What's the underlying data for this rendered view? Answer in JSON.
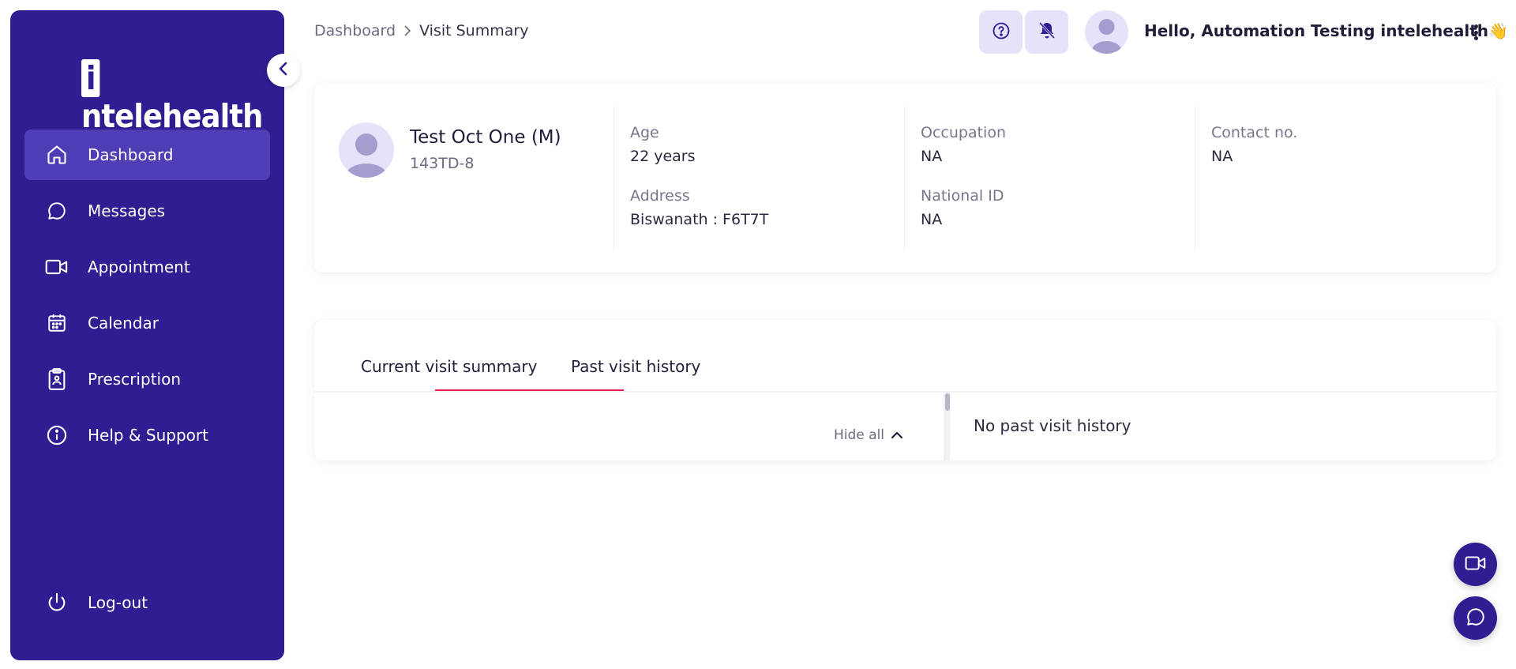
{
  "app": {
    "logo_text": "intelehealth"
  },
  "sidebar": {
    "items": [
      {
        "label": "Dashboard",
        "icon": "home-icon",
        "active": true
      },
      {
        "label": "Messages",
        "icon": "chat-bubble-icon",
        "active": false
      },
      {
        "label": "Appointment",
        "icon": "video-camera-icon",
        "active": false
      },
      {
        "label": "Calendar",
        "icon": "calendar-icon",
        "active": false
      },
      {
        "label": "Prescription",
        "icon": "clipboard-icon",
        "active": false
      },
      {
        "label": "Help & Support",
        "icon": "info-icon",
        "active": false
      }
    ],
    "logout_label": "Log-out"
  },
  "breadcrumb": {
    "root": "Dashboard",
    "current": "Visit Summary"
  },
  "header": {
    "greeting": "Hello, Automation Testing intelehealth",
    "greeting_emoji": "👋"
  },
  "patient": {
    "name": "Test Oct One (M)",
    "id": "143TD-8",
    "age_label": "Age",
    "age_value": "22 years",
    "address_label": "Address",
    "address_value": "Biswanath : F6T7T",
    "occupation_label": "Occupation",
    "occupation_value": "NA",
    "national_id_label": "National ID",
    "national_id_value": "NA",
    "contact_label": "Contact no.",
    "contact_value": "NA"
  },
  "visit": {
    "tabs": [
      {
        "label": "Current visit summary",
        "active": false
      },
      {
        "label": "Past visit history",
        "active": true
      }
    ],
    "hide_all_label": "Hide all",
    "no_history_text": "No past visit history"
  },
  "colors": {
    "sidebar_bg": "#2e1e91",
    "sidebar_active": "#4e3eb6",
    "accent_light": "#e6e2fa",
    "tab_underline": "#e8234b"
  }
}
